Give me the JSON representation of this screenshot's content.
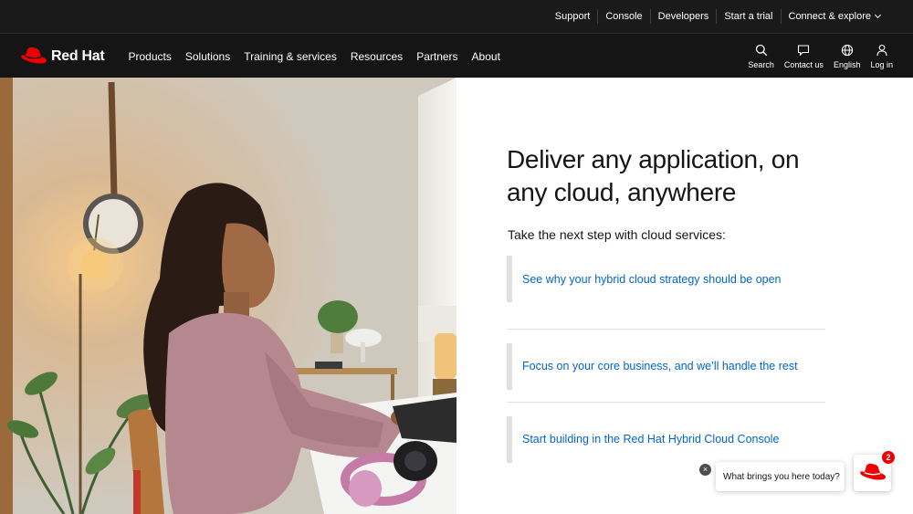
{
  "utility_nav": {
    "items": [
      {
        "label": "Support"
      },
      {
        "label": "Console"
      },
      {
        "label": "Developers"
      },
      {
        "label": "Start a trial"
      },
      {
        "label": "Connect & explore"
      }
    ]
  },
  "main_nav": {
    "logo_text": "Red Hat",
    "items": [
      {
        "label": "Products"
      },
      {
        "label": "Solutions"
      },
      {
        "label": "Training & services"
      },
      {
        "label": "Resources"
      },
      {
        "label": "Partners"
      },
      {
        "label": "About"
      }
    ],
    "icons": [
      {
        "label": "Search",
        "icon": "search-icon"
      },
      {
        "label": "Contact us",
        "icon": "chat-icon"
      },
      {
        "label": "English",
        "icon": "globe-icon"
      },
      {
        "label": "Log in",
        "icon": "user-icon"
      }
    ]
  },
  "hero": {
    "headline": "Deliver any application, on any cloud, anywhere",
    "subhead": "Take the next step with cloud services:",
    "links": [
      {
        "label": "See why your hybrid cloud strategy should be open"
      },
      {
        "label": "Focus on your core business, and we’ll handle the rest"
      },
      {
        "label": "Start building in the Red Hat Hybrid Cloud Console"
      }
    ]
  },
  "chat": {
    "prompt": "What brings you here today?",
    "badge_count": "2",
    "close_symbol": "×"
  },
  "colors": {
    "brand_red": "#ee0000",
    "link_blue": "#0066cc",
    "nav_bg": "#151515",
    "utility_bg": "#1a1a1a"
  }
}
